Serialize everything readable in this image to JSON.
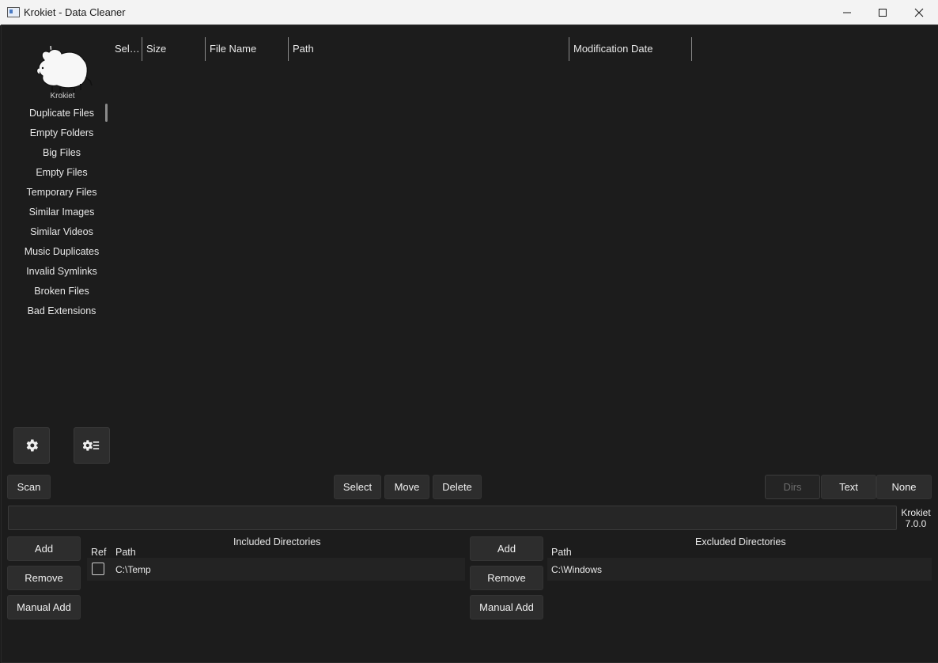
{
  "window": {
    "title": "Krokiet - Data Cleaner",
    "minimize": "minimize",
    "maximize": "maximize",
    "close": "close"
  },
  "logo": {
    "text": "Krokiet"
  },
  "sidebar": {
    "items": [
      {
        "label": "Duplicate Files"
      },
      {
        "label": "Empty Folders"
      },
      {
        "label": "Big Files"
      },
      {
        "label": "Empty Files"
      },
      {
        "label": "Temporary Files"
      },
      {
        "label": "Similar Images"
      },
      {
        "label": "Similar Videos"
      },
      {
        "label": "Music Duplicates"
      },
      {
        "label": "Invalid Symlinks"
      },
      {
        "label": "Broken Files"
      },
      {
        "label": "Bad Extensions"
      }
    ],
    "settings_icon": "gear-icon",
    "subsettings_icon": "gear-list-icon"
  },
  "table": {
    "columns": [
      "Sel…",
      "Size",
      "File Name",
      "Path",
      "Modification Date"
    ],
    "rows": []
  },
  "toolbar": {
    "scan": "Scan",
    "select": "Select",
    "move": "Move",
    "delete": "Delete",
    "dirs": "Dirs",
    "text": "Text",
    "none": "None"
  },
  "version": {
    "name": "Krokiet",
    "number": "7.0.0"
  },
  "included": {
    "title": "Included Directories",
    "add": "Add",
    "remove": "Remove",
    "manual_add": "Manual Add",
    "col_ref": "Ref",
    "col_path": "Path",
    "rows": [
      {
        "ref": false,
        "path": "C:\\Temp"
      }
    ]
  },
  "excluded": {
    "title": "Excluded Directories",
    "add": "Add",
    "remove": "Remove",
    "manual_add": "Manual Add",
    "col_path": "Path",
    "rows": [
      {
        "path": "C:\\Windows"
      }
    ]
  }
}
